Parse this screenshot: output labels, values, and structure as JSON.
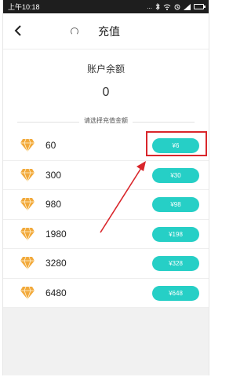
{
  "status_bar": {
    "time": "上午10:18",
    "indicators": "..."
  },
  "nav": {
    "back_label": "<",
    "title": "充值"
  },
  "balance": {
    "label": "账户余额",
    "value": "0"
  },
  "choose_label": "请选择充值金额",
  "packages": [
    {
      "amount": "60",
      "price": "¥6"
    },
    {
      "amount": "300",
      "price": "¥30"
    },
    {
      "amount": "980",
      "price": "¥98"
    },
    {
      "amount": "1980",
      "price": "¥198"
    },
    {
      "amount": "3280",
      "price": "¥328"
    },
    {
      "amount": "6480",
      "price": "¥648"
    }
  ],
  "colors": {
    "accent": "#26cfc6",
    "annotation": "#d9262b",
    "gem": "#f2a93b"
  },
  "icons": {
    "gem": "diamond-icon",
    "back": "back-arrow-icon",
    "loading": "loading-icon"
  }
}
